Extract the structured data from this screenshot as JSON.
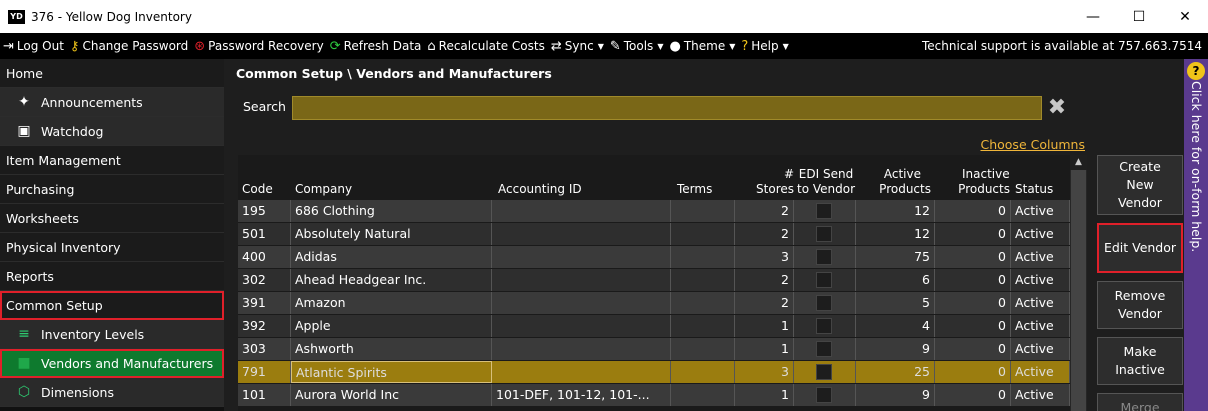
{
  "window": {
    "logo_text": "YD",
    "title": "376  - Yellow Dog Inventory",
    "minimize_glyph": "—",
    "maximize_glyph": "☐",
    "close_glyph": "✕"
  },
  "menubar": {
    "items": [
      {
        "label": "Log Out",
        "icon": "logout-icon",
        "glyph": "⇥",
        "color": "#ffffff",
        "caret": ""
      },
      {
        "label": "Change Password",
        "icon": "key-icon",
        "glyph": "⚷",
        "color": "#f0c419",
        "caret": ""
      },
      {
        "label": "Password Recovery",
        "icon": "lifebuoy-icon",
        "glyph": "⊛",
        "color": "#e0202a",
        "caret": ""
      },
      {
        "label": "Refresh Data",
        "icon": "refresh-icon",
        "glyph": "⟳",
        "color": "#2ecc40",
        "caret": ""
      },
      {
        "label": "Recalculate Costs",
        "icon": "bank-icon",
        "glyph": "⌂",
        "color": "#ffffff",
        "caret": ""
      },
      {
        "label": "Sync",
        "icon": "sync-arrows-icon",
        "glyph": "⇄",
        "color": "#ffffff",
        "caret": "▼"
      },
      {
        "label": "Tools",
        "icon": "wrench-icon",
        "glyph": "✎",
        "color": "#ffffff",
        "caret": "▼"
      },
      {
        "label": "Theme",
        "icon": "palette-icon",
        "glyph": "●",
        "color": "#ffffff",
        "caret": "▼"
      },
      {
        "label": "Help",
        "icon": "help-circle-icon",
        "glyph": "?",
        "color": "#f0c419",
        "caret": "▼"
      }
    ],
    "support_text": "Technical support is available at 757.663.7514"
  },
  "sidebar": {
    "items": [
      {
        "label": "Home",
        "level": "top",
        "icon": "",
        "glyph": "",
        "icon_color": "",
        "state": ""
      },
      {
        "label": "Announcements",
        "level": "sub",
        "icon": "megaphone-icon",
        "glyph": "✦",
        "icon_color": "#ffffff",
        "state": ""
      },
      {
        "label": "Watchdog",
        "level": "sub",
        "icon": "dog-icon",
        "glyph": "▣",
        "icon_color": "#ffffff",
        "state": ""
      },
      {
        "label": "Item Management",
        "level": "top",
        "icon": "",
        "glyph": "",
        "icon_color": "",
        "state": ""
      },
      {
        "label": "Purchasing",
        "level": "top",
        "icon": "",
        "glyph": "",
        "icon_color": "",
        "state": ""
      },
      {
        "label": "Worksheets",
        "level": "top",
        "icon": "",
        "glyph": "",
        "icon_color": "",
        "state": ""
      },
      {
        "label": "Physical Inventory",
        "level": "top",
        "icon": "",
        "glyph": "",
        "icon_color": "",
        "state": ""
      },
      {
        "label": "Reports",
        "level": "top",
        "icon": "",
        "glyph": "",
        "icon_color": "",
        "state": ""
      },
      {
        "label": "Common Setup",
        "level": "top",
        "icon": "",
        "glyph": "",
        "icon_color": "",
        "state": "outlined"
      },
      {
        "label": "Inventory Levels",
        "level": "sub",
        "icon": "levels-icon",
        "glyph": "≡",
        "icon_color": "#2ecc71",
        "state": ""
      },
      {
        "label": "Vendors and Manufacturers",
        "level": "sub",
        "icon": "truck-icon",
        "glyph": "■",
        "icon_color": "#1fa84a",
        "state": "selected"
      },
      {
        "label": "Dimensions",
        "level": "sub",
        "icon": "cube-icon",
        "glyph": "⬡",
        "icon_color": "#2ecc71",
        "state": ""
      }
    ]
  },
  "main": {
    "breadcrumb": "Common Setup \\ Vendors and Manufacturers",
    "search_label": "Search",
    "search_value": "",
    "choose_columns": "Choose Columns",
    "columns": {
      "code": "Code",
      "company": "Company",
      "accounting_id": "Accounting ID",
      "terms": "Terms",
      "stores_line1": "#",
      "stores_line2": "Stores",
      "edi_line1": "EDI Send",
      "edi_line2": "to Vendor",
      "active_line1": "Active",
      "active_line2": "Products",
      "inactive_line1": "Inactive",
      "inactive_line2": "Products",
      "status": "Status"
    },
    "rows": [
      {
        "code": "195",
        "company": "686 Clothing",
        "accounting_id": "",
        "terms": "",
        "stores": "2",
        "active": "12",
        "inactive": "0",
        "status": "Active",
        "highlight": false
      },
      {
        "code": "501",
        "company": "Absolutely Natural",
        "accounting_id": "",
        "terms": "",
        "stores": "2",
        "active": "12",
        "inactive": "0",
        "status": "Active",
        "highlight": false
      },
      {
        "code": "400",
        "company": "Adidas",
        "accounting_id": "",
        "terms": "",
        "stores": "3",
        "active": "75",
        "inactive": "0",
        "status": "Active",
        "highlight": false
      },
      {
        "code": "302",
        "company": "Ahead Headgear Inc.",
        "accounting_id": "",
        "terms": "",
        "stores": "2",
        "active": "6",
        "inactive": "0",
        "status": "Active",
        "highlight": false
      },
      {
        "code": "391",
        "company": "Amazon",
        "accounting_id": "",
        "terms": "",
        "stores": "2",
        "active": "5",
        "inactive": "0",
        "status": "Active",
        "highlight": false
      },
      {
        "code": "392",
        "company": "Apple",
        "accounting_id": "",
        "terms": "",
        "stores": "1",
        "active": "4",
        "inactive": "0",
        "status": "Active",
        "highlight": false
      },
      {
        "code": "303",
        "company": "Ashworth",
        "accounting_id": "",
        "terms": "",
        "stores": "1",
        "active": "9",
        "inactive": "0",
        "status": "Active",
        "highlight": false
      },
      {
        "code": "791",
        "company": "Atlantic Spirits",
        "accounting_id": "",
        "terms": "",
        "stores": "3",
        "active": "25",
        "inactive": "0",
        "status": "Active",
        "highlight": true
      },
      {
        "code": "101",
        "company": "Aurora World Inc",
        "accounting_id": "101-DEF, 101-12, 101-...",
        "terms": "",
        "stores": "1",
        "active": "9",
        "inactive": "0",
        "status": "Active",
        "highlight": false
      }
    ],
    "actions": [
      {
        "name": "create-new-vendor-button",
        "label": "Create New Vendor",
        "outlined": false
      },
      {
        "name": "edit-vendor-button",
        "label": "Edit Vendor",
        "outlined": true
      },
      {
        "name": "remove-vendor-button",
        "label": "Remove Vendor",
        "outlined": false
      },
      {
        "name": "make-inactive-button",
        "label": "Make Inactive",
        "outlined": false
      },
      {
        "name": "merge-button",
        "label": "Merge",
        "outlined": false
      }
    ]
  },
  "help_panel": {
    "icon_glyph": "?",
    "text": "Click here for on-form help."
  },
  "colors": {
    "accent_gold": "#f0b63a",
    "search_bg": "#7a6717",
    "highlight_row": "#9b7d0f",
    "selected_nav": "#0e7a2e",
    "annotation_red": "#e0202a",
    "help_purple": "#5a3a8e"
  }
}
